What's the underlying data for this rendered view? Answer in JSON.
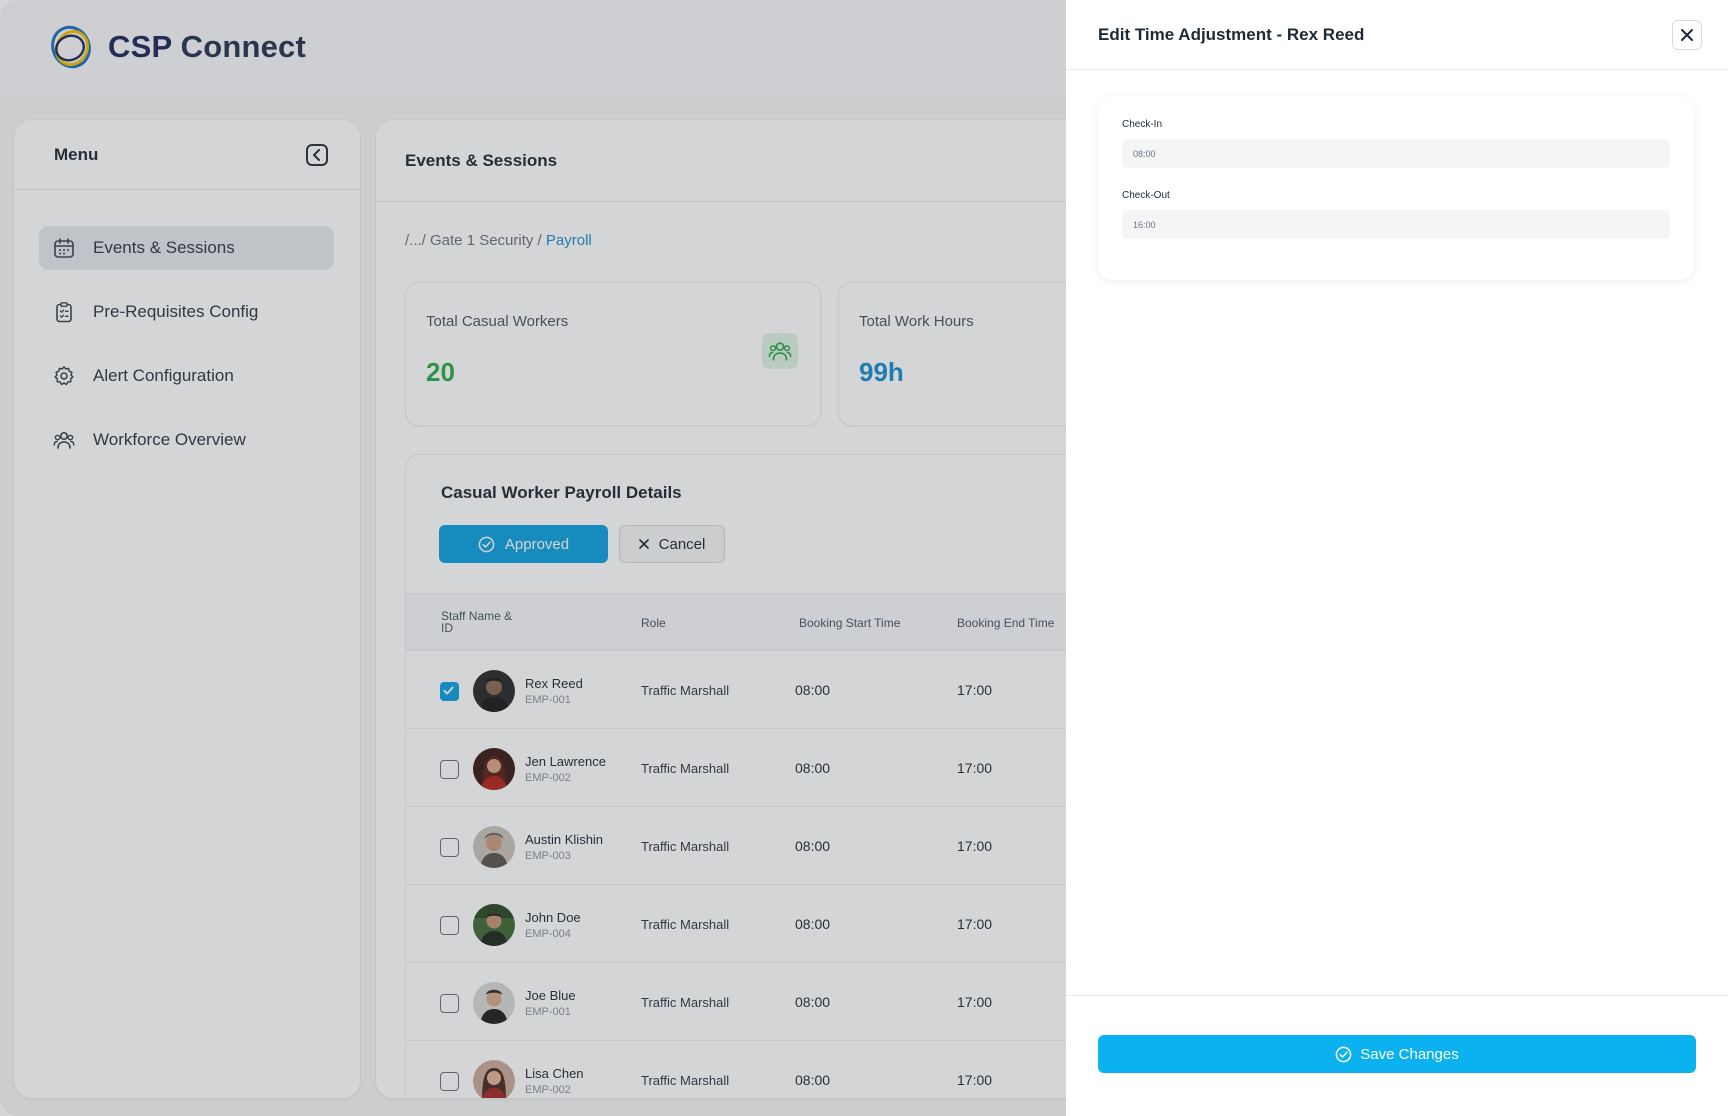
{
  "brand": {
    "name_part1": "CSP",
    "name_part2": "Connect"
  },
  "sidebar": {
    "title": "Menu",
    "items": [
      {
        "label": "Events & Sessions",
        "icon": "calendar-icon",
        "active": true
      },
      {
        "label": "Pre-Requisites Config",
        "icon": "clipboard-icon",
        "active": false
      },
      {
        "label": "Alert Configuration",
        "icon": "gear-icon",
        "active": false
      },
      {
        "label": "Workforce Overview",
        "icon": "users-icon",
        "active": false
      }
    ]
  },
  "main": {
    "title": "Events & Sessions",
    "breadcrumb": {
      "prefix": "/.../ Gate 1 Security /",
      "current": "Payroll"
    },
    "stats": [
      {
        "label": "Total Casual Workers",
        "value": "20"
      },
      {
        "label": "Total Work Hours",
        "value": "99h"
      }
    ],
    "table": {
      "title": "Casual Worker Payroll Details",
      "approved_label": "Approved",
      "cancel_label": "Cancel",
      "headers": {
        "name": "Staff Name & ID",
        "role": "Role",
        "start": "Booking Start Time",
        "end": "Booking End Time"
      },
      "rows": [
        {
          "name": "Rex Reed",
          "id": "EMP-001",
          "role": "Traffic Marshall",
          "start": "08:00",
          "end": "17:00",
          "checked": true
        },
        {
          "name": "Jen Lawrence",
          "id": "EMP-002",
          "role": "Traffic Marshall",
          "start": "08:00",
          "end": "17:00",
          "checked": false
        },
        {
          "name": "Austin Klishin",
          "id": "EMP-003",
          "role": "Traffic Marshall",
          "start": "08:00",
          "end": "17:00",
          "checked": false
        },
        {
          "name": "John Doe",
          "id": "EMP-004",
          "role": "Traffic Marshall",
          "start": "08:00",
          "end": "17:00",
          "checked": false
        },
        {
          "name": "Joe Blue",
          "id": "EMP-001",
          "role": "Traffic Marshall",
          "start": "08:00",
          "end": "17:00",
          "checked": false
        },
        {
          "name": "Lisa Chen",
          "id": "EMP-002",
          "role": "Traffic Marshall",
          "start": "08:00",
          "end": "17:00",
          "checked": false
        }
      ]
    }
  },
  "drawer": {
    "title": "Edit Time Adjustment - Rex Reed",
    "check_in": {
      "label": "Check-In",
      "value": "08:00"
    },
    "check_out": {
      "label": "Check-Out",
      "value": "16:00"
    },
    "save_label": "Save Changes"
  },
  "colors": {
    "accent": "#0D9FE0",
    "save": "#0CB2F0",
    "green": "#2EAA4C",
    "brand_navy": "#1C2A5C"
  }
}
